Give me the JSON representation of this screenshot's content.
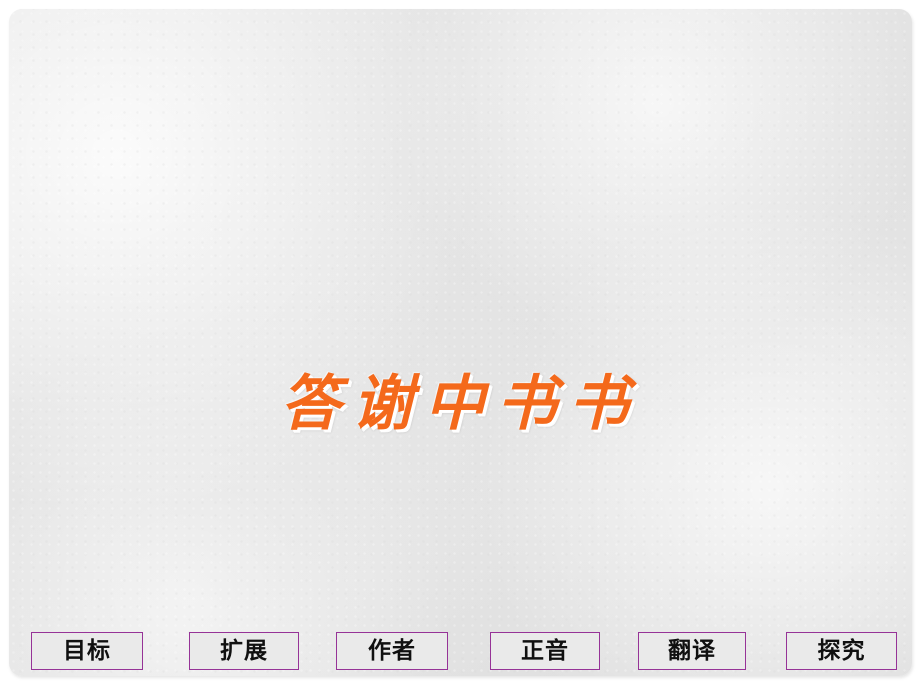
{
  "slide": {
    "title": "答谢中书书",
    "title_color": "#F4691B",
    "title_shadow_color": "#FFFFFF",
    "background_color": "#E3E3E3"
  },
  "nav": {
    "border_color": "#963397",
    "fill_color": "#EAEAEA",
    "label_color": "#101010",
    "buttons": [
      {
        "label": "目标"
      },
      {
        "label": "扩展"
      },
      {
        "label": "作者"
      },
      {
        "label": "正音"
      },
      {
        "label": "翻译"
      },
      {
        "label": "探究"
      }
    ]
  }
}
